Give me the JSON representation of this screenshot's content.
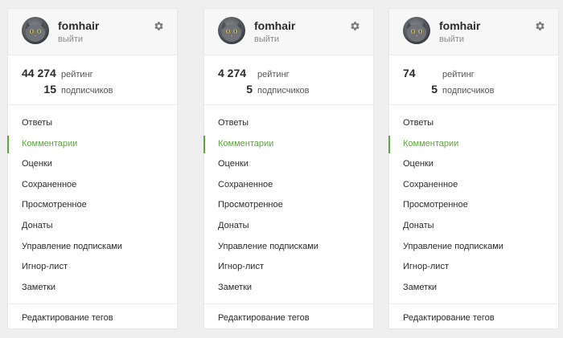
{
  "colors": {
    "accent": "#5da53e",
    "header_bg": "#f7f7f7",
    "page_bg": "#efefef"
  },
  "panels": [
    {
      "username": "fomhair",
      "logout": "выйти",
      "stats": [
        {
          "value": "44 274",
          "label": "рейтинг"
        },
        {
          "value": "15",
          "label": "подписчиков"
        }
      ],
      "menu": [
        "Ответы",
        "Комментарии",
        "Оценки",
        "Сохраненное",
        "Просмотренное",
        "Донаты",
        "Управление подписками",
        "Игнор-лист",
        "Заметки"
      ],
      "active_item": "Комментарии",
      "footer": "Редактирование тегов"
    },
    {
      "username": "fomhair",
      "logout": "выйти",
      "stats": [
        {
          "value": "4 274",
          "label": "рейтинг"
        },
        {
          "value": "5",
          "label": "подписчиков"
        }
      ],
      "menu": [
        "Ответы",
        "Комментарии",
        "Оценки",
        "Сохраненное",
        "Просмотренное",
        "Донаты",
        "Управление подписками",
        "Игнор-лист",
        "Заметки"
      ],
      "active_item": "Комментарии",
      "footer": "Редактирование тегов"
    },
    {
      "username": "fomhair",
      "logout": "выйти",
      "stats": [
        {
          "value": "74",
          "label": "рейтинг"
        },
        {
          "value": "5",
          "label": "подписчиков"
        }
      ],
      "menu": [
        "Ответы",
        "Комментарии",
        "Оценки",
        "Сохраненное",
        "Просмотренное",
        "Донаты",
        "Управление подписками",
        "Игнор-лист",
        "Заметки"
      ],
      "active_item": "Комментарии",
      "footer": "Редактирование тегов"
    }
  ]
}
